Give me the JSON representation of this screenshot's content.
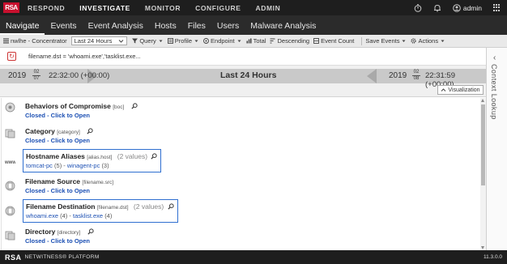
{
  "app": {
    "logo_text": "RSA",
    "top_nav": [
      {
        "label": "RESPOND",
        "active": false
      },
      {
        "label": "INVESTIGATE",
        "active": true
      },
      {
        "label": "MONITOR",
        "active": false
      },
      {
        "label": "CONFIGURE",
        "active": false
      },
      {
        "label": "ADMIN",
        "active": false
      }
    ],
    "user": "admin"
  },
  "sub_nav": [
    {
      "label": "Navigate",
      "active": true
    },
    {
      "label": "Events",
      "active": false
    },
    {
      "label": "Event Analysis",
      "active": false
    },
    {
      "label": "Hosts",
      "active": false
    },
    {
      "label": "Files",
      "active": false
    },
    {
      "label": "Users",
      "active": false
    },
    {
      "label": "Malware Analysis",
      "active": false
    }
  ],
  "toolbar": {
    "service": "nwlhe - Concentrator",
    "time_range": "Last 24 Hours",
    "query": "Query",
    "profile": "Profile",
    "endpoint": "Endpoint",
    "total": "Total",
    "descending": "Descending",
    "event_count": "Event Count",
    "save_events": "Save Events",
    "actions": "Actions"
  },
  "query": {
    "text": "filename.dst = 'whoami.exe','tasklist.exe..."
  },
  "timeline": {
    "start_year": "2019",
    "start_month": "02",
    "start_day": "07",
    "start_time": "22:32:00 (+00:00)",
    "center_label": "Last 24 Hours",
    "end_year": "2019",
    "end_month": "02",
    "end_day": "08",
    "end_time": "22:31:59 (+00:00)",
    "visualization_label": "Visualization"
  },
  "meta_groups": [
    {
      "title": "Behaviors of Compromise",
      "key": "[boc]",
      "status": "Closed - Click to Open"
    },
    {
      "title": "Category",
      "key": "[category]",
      "status": "Closed - Click to Open"
    },
    {
      "title": "Hostname Aliases",
      "key": "[alias.host]",
      "count": "(2 values)",
      "values": [
        {
          "name": "tomcat-pc",
          "n": "(5)"
        },
        {
          "name": "winagent-pc",
          "n": "(3)"
        }
      ]
    },
    {
      "title": "Filename Source",
      "key": "[filename.src]",
      "status": "Closed - Click to Open"
    },
    {
      "title": "Filename Destination",
      "key": "[filename.dst]",
      "count": "(2 values)",
      "values": [
        {
          "name": "whoami.exe",
          "n": "(4)"
        },
        {
          "name": "tasklist.exe",
          "n": "(4)"
        }
      ]
    },
    {
      "title": "Directory",
      "key": "[directory]",
      "status": "Closed - Click to Open"
    }
  ],
  "context_panel": {
    "label": "Context Lookup"
  },
  "footer": {
    "brand": "RSA",
    "platform": "NETWITNESS® PLATFORM",
    "version": "11.3.0.0"
  },
  "colors": {
    "topbar": "#1e1e1e",
    "subnav": "#2b2b2b",
    "link_blue": "#1b4fb3",
    "highlight_border": "#2f6fd0",
    "logo_red": "#c8102e"
  }
}
